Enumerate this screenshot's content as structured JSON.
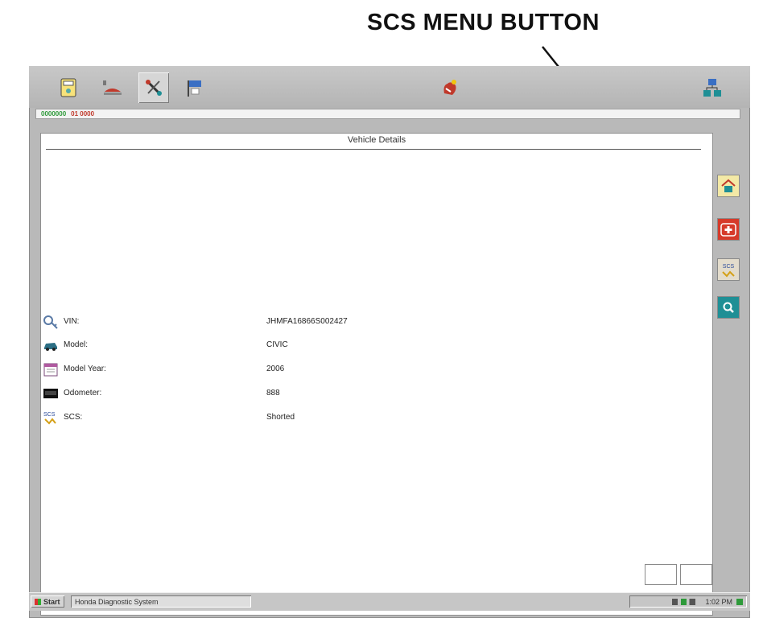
{
  "callout": {
    "text": "SCS MENU BUTTON"
  },
  "toolbar": {
    "buttons": [
      {
        "icon": "manual-book-icon"
      },
      {
        "icon": "vehicle-lift-icon"
      },
      {
        "icon": "tools-icon"
      },
      {
        "icon": "flag-icon"
      },
      {
        "icon": "hand-clean-icon"
      },
      {
        "icon": "network-diagnostic-icon"
      }
    ]
  },
  "status": {
    "part1": "0000000",
    "part2": "01 0000"
  },
  "panel": {
    "title": "Vehicle Details",
    "rows": [
      {
        "label": "VIN:",
        "value": "JHMFA16866S002427",
        "icon": "key-icon"
      },
      {
        "label": "Model:",
        "value": "CIVIC",
        "icon": "car-icon"
      },
      {
        "label": "Model Year:",
        "value": "2006",
        "icon": "calendar-icon"
      },
      {
        "label": "Odometer:",
        "value": "888",
        "icon": "odometer-icon"
      },
      {
        "label": "SCS:",
        "value": "Shorted",
        "icon": "scs-connector-icon"
      }
    ]
  },
  "sidebar": {
    "buttons": [
      {
        "icon": "home-icon"
      },
      {
        "icon": "first-aid-icon"
      },
      {
        "icon": "scs-menu-icon",
        "label": "SCS"
      },
      {
        "icon": "search-help-icon"
      }
    ]
  },
  "taskbar": {
    "start": "Start",
    "task": "Honda Diagnostic System",
    "clock": "1:02 PM"
  },
  "colors": {
    "accent_teal": "#1f8f95",
    "status_green": "#2e9a3a",
    "status_red": "#c0392b"
  }
}
